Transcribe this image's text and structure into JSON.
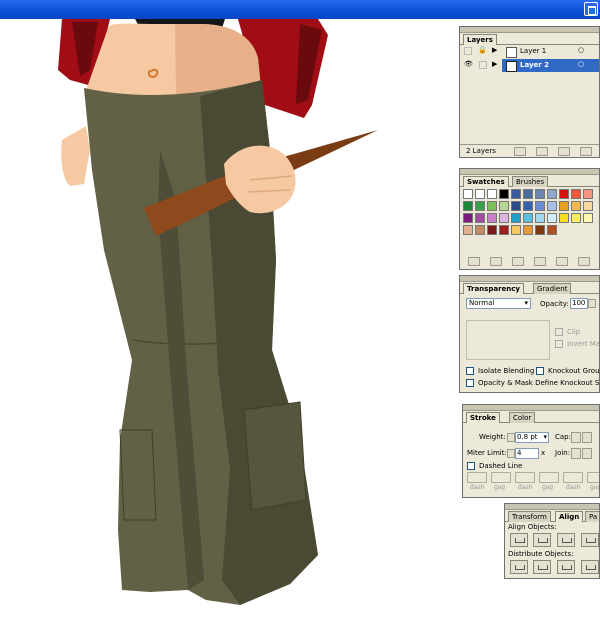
{
  "window": {
    "restore_icon": "restore-window-icon"
  },
  "layers": {
    "tab": "Layers",
    "rows": [
      {
        "name": "Layer 1",
        "selected": false
      },
      {
        "name": "Layer 2",
        "selected": true
      }
    ],
    "count": "2 Layers"
  },
  "swatches": {
    "tabs": [
      "Swatches",
      "Brushes"
    ],
    "colors": [
      "#ffffff",
      "#ffffff",
      "#ffffff",
      "#000000",
      "#3a5aa0",
      "#4c6c9c",
      "#6b86b4",
      "#8ea6c8",
      "#d41010",
      "#f05a3c",
      "#f49480",
      "#1a8a3a",
      "#3aa04a",
      "#7ac05a",
      "#b4d890",
      "#2e4c8a",
      "#3c60b0",
      "#6a8ed4",
      "#a8c0e8",
      "#e8a020",
      "#f0b850",
      "#f8d8a0",
      "#7a1a7a",
      "#a04ca0",
      "#c880c8",
      "#e0b4e0",
      "#20a0c8",
      "#5cc0e0",
      "#a0d8f0",
      "#d0eef8",
      "#f8e020",
      "#fcec60",
      "#fef8b0",
      "#e0b090",
      "#c48a60",
      "#7a1a1a",
      "#a02020",
      "#f4c860",
      "#e89838",
      "#803810",
      "#b05020"
    ]
  },
  "transparency": {
    "tabs": [
      "Transparency",
      "Gradient"
    ],
    "mode": "Normal",
    "opacity_label": "Opacity:",
    "opacity_value": "100",
    "clip": "Clip",
    "invert_mask": "Invert Mas",
    "isolate_blending": "Isolate Blending",
    "knockout_group": "Knockout Group",
    "opacity_mask": "Opacity & Mask Define Knockout Shape"
  },
  "stroke": {
    "tabs": [
      "Stroke",
      "Color"
    ],
    "weight_label": "Weight:",
    "weight_value": "0.8 pt",
    "cap_label": "Cap:",
    "miter_label": "Miter Limit:",
    "miter_value": "4",
    "miter_x": "x",
    "join_label": "Join:",
    "dashed_line": "Dashed Line",
    "dash_labels": [
      "dash",
      "gap",
      "dash",
      "gap",
      "dash",
      "gap"
    ]
  },
  "align": {
    "tabs": [
      "Transform",
      "Align",
      "Pa"
    ],
    "align_objects": "Align Objects:",
    "distribute_objects": "Distribute Objects:"
  }
}
